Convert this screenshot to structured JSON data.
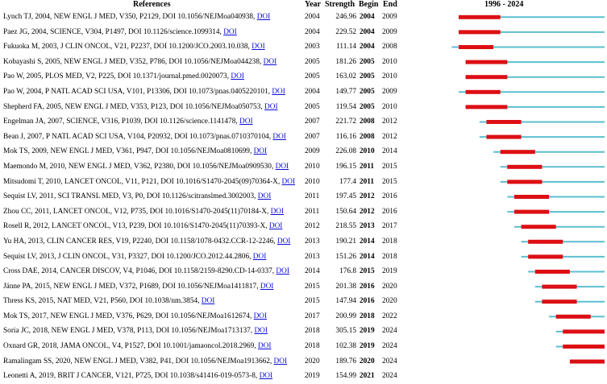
{
  "header": {
    "references": "References",
    "year": "Year",
    "strength": "Strength",
    "begin": "Begin",
    "end": "End",
    "range": "1996 - 2024"
  },
  "colors": {
    "background_line": "#5cbfcf",
    "burst": "#dd0f14",
    "link": "#0b0bd6"
  },
  "chart_data": {
    "type": "table",
    "timeline_start": 1996,
    "timeline_end": 2024,
    "columns": [
      "References",
      "Year",
      "Strength",
      "Begin",
      "End",
      "1996 - 2024"
    ],
    "rows": [
      {
        "ref": "Lynch TJ, 2004, NEW ENGL J MED, V350, P2129, DOI 10.1056/NEJMoa040938,",
        "doi": "DOI",
        "year": "2004",
        "strength": "246.96",
        "begin": "2004",
        "end": "2009"
      },
      {
        "ref": "Paez JG, 2004, SCIENCE, V304, P1497, DOI 10.1126/science.1099314,",
        "doi": "DOI",
        "year": "2004",
        "strength": "229.52",
        "begin": "2004",
        "end": "2009"
      },
      {
        "ref": "Fukuoka M, 2003, J CLIN ONCOL, V21, P2237, DOI 10.1200/JCO.2003.10.038,",
        "doi": "DOI",
        "year": "2003",
        "strength": "111.14",
        "begin": "2004",
        "end": "2008"
      },
      {
        "ref": "Kobayashi S, 2005, NEW ENGL J MED, V352, P786, DOI 10.1056/NEJMoa044238,",
        "doi": "DOI",
        "year": "2005",
        "strength": "181.26",
        "begin": "2005",
        "end": "2010"
      },
      {
        "ref": "Pao W, 2005, PLOS MED, V2, P225, DOI 10.1371/journal.pmed.0020073,",
        "doi": "DOI",
        "year": "2005",
        "strength": "163.02",
        "begin": "2005",
        "end": "2010"
      },
      {
        "ref": "Pao W, 2004, P NATL ACAD SCI USA, V101, P13306, DOI 10.1073/pnas.0405220101,",
        "doi": "DOI",
        "year": "2004",
        "strength": "149.77",
        "begin": "2005",
        "end": "2009"
      },
      {
        "ref": "Shepherd FA, 2005, NEW ENGL J MED, V353, P123, DOI 10.1056/NEJMoa050753,",
        "doi": "DOI",
        "year": "2005",
        "strength": "119.54",
        "begin": "2005",
        "end": "2010"
      },
      {
        "ref": "Engelman JA, 2007, SCIENCE, V316, P1039, DOI 10.1126/science.1141478,",
        "doi": "DOI",
        "year": "2007",
        "strength": "221.72",
        "begin": "2008",
        "end": "2012"
      },
      {
        "ref": "Bean J, 2007, P NATL ACAD SCI USA, V104, P20932, DOI 10.1073/pnas.0710370104,",
        "doi": "DOI",
        "year": "2007",
        "strength": "116.16",
        "begin": "2008",
        "end": "2012"
      },
      {
        "ref": "Mok TS, 2009, NEW ENGL J MED, V361, P947, DOI 10.1056/NEJMoa0810699,",
        "doi": "DOI",
        "year": "2009",
        "strength": "226.08",
        "begin": "2010",
        "end": "2014"
      },
      {
        "ref": "Maemondo M, 2010, NEW ENGL J MED, V362, P2380, DOI 10.1056/NEJMoa0909530,",
        "doi": "DOI",
        "year": "2010",
        "strength": "196.15",
        "begin": "2011",
        "end": "2015"
      },
      {
        "ref": "Mitsudomi T, 2010, LANCET ONCOL, V11, P121, DOI 10.1016/S1470-2045(09)70364-X,",
        "doi": "DOI",
        "year": "2010",
        "strength": "177.4",
        "begin": "2011",
        "end": "2015"
      },
      {
        "ref": "Sequist LV, 2011, SCI TRANSL MED, V3, P0, DOI 10.1126/scitranslmed.3002003,",
        "doi": "DOI",
        "year": "2011",
        "strength": "197.45",
        "begin": "2012",
        "end": "2016"
      },
      {
        "ref": "Zhou CC, 2011, LANCET ONCOL, V12, P735, DOI 10.1016/S1470-2045(11)70184-X,",
        "doi": "DOI",
        "year": "2011",
        "strength": "150.64",
        "begin": "2012",
        "end": "2016"
      },
      {
        "ref": "Rosell R, 2012, LANCET ONCOL, V13, P239, DOI 10.1016/S1470-2045(11)70393-X,",
        "doi": "DOI",
        "year": "2012",
        "strength": "218.55",
        "begin": "2013",
        "end": "2017"
      },
      {
        "ref": "Yu HA, 2013, CLIN CANCER RES, V19, P2240, DOI 10.1158/1078-0432.CCR-12-2246,",
        "doi": "DOI",
        "year": "2013",
        "strength": "190.21",
        "begin": "2014",
        "end": "2018"
      },
      {
        "ref": "Sequist LV, 2013, J CLIN ONCOL, V31, P3327, DOI 10.1200/JCO.2012.44.2806,",
        "doi": "DOI",
        "year": "2013",
        "strength": "151.26",
        "begin": "2014",
        "end": "2018"
      },
      {
        "ref": "Cross DAE, 2014, CANCER DISCOV, V4, P1046, DOI 10.1158/2159-8290.CD-14-0337,",
        "doi": "DOI",
        "year": "2014",
        "strength": "176.8",
        "begin": "2015",
        "end": "2019"
      },
      {
        "ref": "Jänne PA, 2015, NEW ENGL J MED, V372, P1689, DOI 10.1056/NEJMoa1411817,",
        "doi": "DOI",
        "year": "2015",
        "strength": "201.38",
        "begin": "2016",
        "end": "2020"
      },
      {
        "ref": "Thress KS, 2015, NAT MED, V21, P560, DOI 10.1038/nm.3854,",
        "doi": "DOI",
        "year": "2015",
        "strength": "147.94",
        "begin": "2016",
        "end": "2020"
      },
      {
        "ref": "Mok TS, 2017, NEW ENGL J MED, V376, P629, DOI 10.1056/NEJMoa1612674,",
        "doi": "DOI",
        "year": "2017",
        "strength": "200.99",
        "begin": "2018",
        "end": "2022"
      },
      {
        "ref": "Soria JC, 2018, NEW ENGL J MED, V378, P113, DOI 10.1056/NEJMoa1713137,",
        "doi": "DOI",
        "year": "2018",
        "strength": "305.15",
        "begin": "2019",
        "end": "2024"
      },
      {
        "ref": "Oxnard GR, 2018, JAMA ONCOL, V4, P1527, DOI 10.1001/jamaoncol.2018.2969,",
        "doi": "DOI",
        "year": "2018",
        "strength": "102.38",
        "begin": "2019",
        "end": "2024"
      },
      {
        "ref": "Ramalingam SS, 2020, NEW ENGL J MED, V382, P41, DOI 10.1056/NEJMoa1913662,",
        "doi": "DOI",
        "year": "2020",
        "strength": "189.76",
        "begin": "2020",
        "end": "2024"
      },
      {
        "ref": "Leonetti A, 2019, BRIT J CANCER, V121, P725, DOI 10.1038/s41416-019-0573-8,",
        "doi": "DOI",
        "year": "2019",
        "strength": "154.99",
        "begin": "2021",
        "end": "2024"
      }
    ]
  }
}
